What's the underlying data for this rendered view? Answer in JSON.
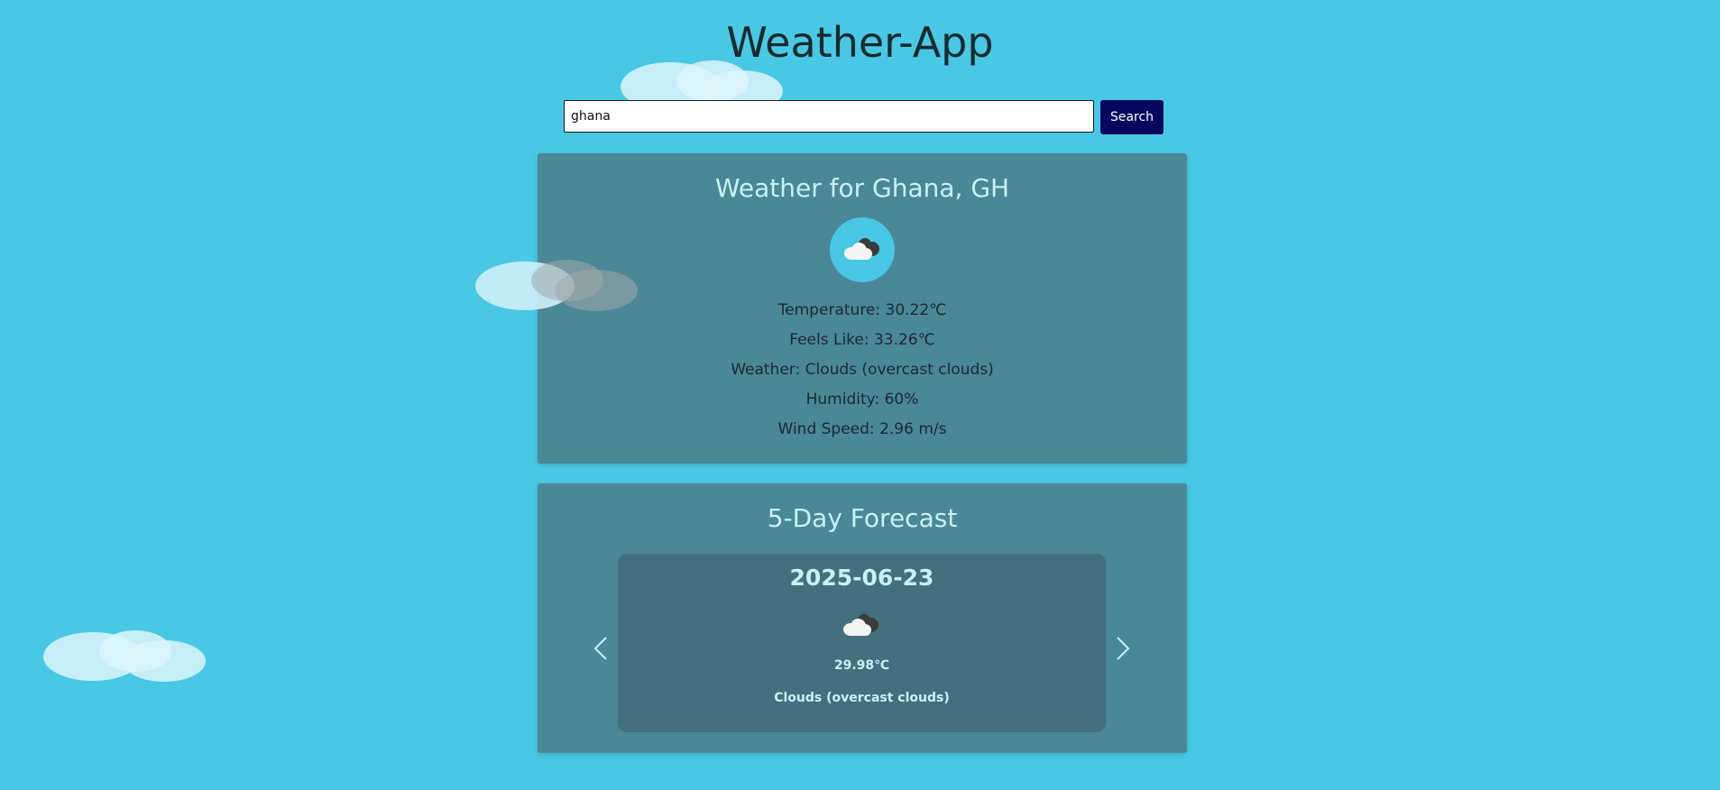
{
  "app": {
    "title": "Weather-App"
  },
  "search": {
    "value": "ghana",
    "button_label": "Search"
  },
  "current": {
    "heading": "Weather for Ghana, GH",
    "icon": "overcast-clouds-icon",
    "details": {
      "temperature": "Temperature: 30.22℃",
      "feels_like": "Feels Like: 33.26℃",
      "weather": "Weather: Clouds (overcast clouds)",
      "humidity": "Humidity: 60%",
      "wind_speed": "Wind Speed: 2.96 m/s"
    }
  },
  "forecast": {
    "heading": "5-Day Forecast",
    "prev_icon": "chevron-left-icon",
    "next_icon": "chevron-right-icon",
    "slide": {
      "date": "2025-06-23",
      "icon": "overcast-clouds-icon",
      "temperature": "29.98℃",
      "description": "Clouds (overcast clouds)"
    }
  },
  "colors": {
    "background": "#48c8e4",
    "card": "#4a7d8c",
    "search_button": "#05075e",
    "heading_text": "#c6f1f8"
  }
}
